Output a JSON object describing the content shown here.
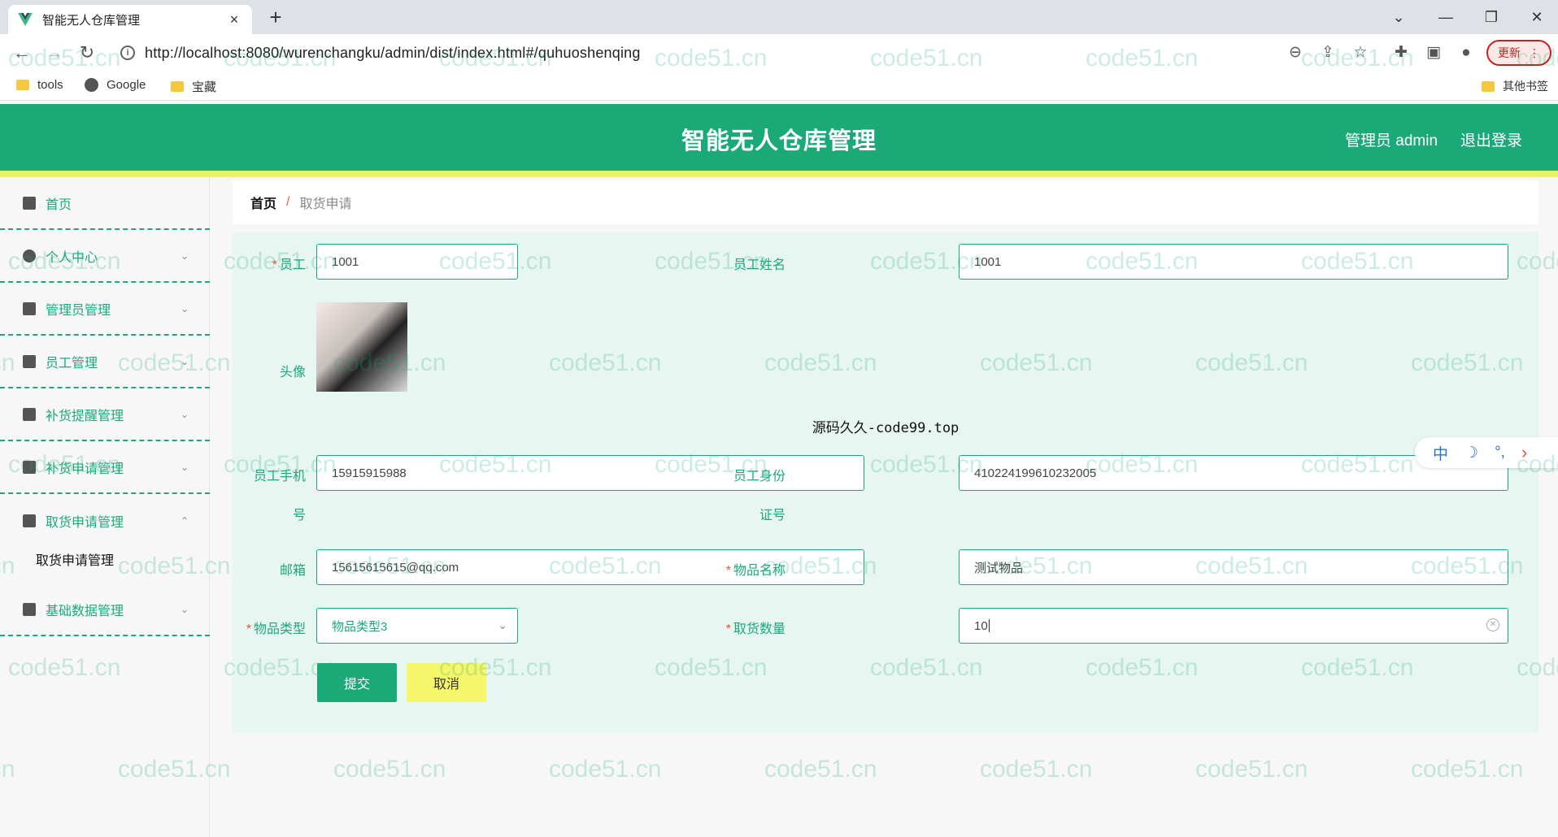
{
  "browser": {
    "tab_title": "智能无人仓库管理",
    "tab_close": "×",
    "new_tab": "+",
    "url": "http://localhost:8080/wurenchangku/admin/dist/index.html#/quhuoshenqing",
    "url_host": "localhost",
    "update_label": "更新",
    "bookmarks": [
      {
        "label": "tools",
        "icon": "folder-icon"
      },
      {
        "label": "Google",
        "icon": "globe-icon"
      },
      {
        "label": "宝藏",
        "icon": "folder-icon"
      }
    ],
    "other_bookmarks": "其他书签"
  },
  "header": {
    "title": "智能无人仓库管理",
    "user": "管理员 admin",
    "logout": "退出登录"
  },
  "sidebar": {
    "items": [
      {
        "label": "首页",
        "icon": "home-icon",
        "arrow": ""
      },
      {
        "label": "个人中心",
        "icon": "user-icon",
        "arrow": "⌄"
      },
      {
        "label": "管理员管理",
        "icon": "briefcase-icon",
        "arrow": "⌄"
      },
      {
        "label": "员工管理",
        "icon": "chat-icon",
        "arrow": "⌄"
      },
      {
        "label": "补货提醒管理",
        "icon": "box-icon",
        "arrow": "⌄"
      },
      {
        "label": "补货申请管理",
        "icon": "grid-icon",
        "arrow": "⌄"
      },
      {
        "label": "取货申请管理",
        "icon": "inbox-icon",
        "arrow": "⌃"
      },
      {
        "label": "基础数据管理",
        "icon": "flag-icon",
        "arrow": "⌄"
      }
    ],
    "submenu": "取货申请管理"
  },
  "breadcrumb": {
    "home": "首页",
    "sep": "/",
    "current": "取货申请"
  },
  "form": {
    "employee_label": "员工",
    "employee_value": "1001",
    "employee_name_label": "员工姓名",
    "employee_name_value": "1001",
    "avatar_label": "头像",
    "watermark_line": "源码久久-code99.top",
    "phone_label_1": "员工手机",
    "phone_label_2": "号",
    "phone_value": "15915915988",
    "id_label_1": "员工身份",
    "id_label_2": "证号",
    "id_value": "410224199610232005",
    "email_label": "邮箱",
    "email_value": "15615615615@qq.com",
    "item_name_label": "物品名称",
    "item_name_value": "测试物品",
    "item_type_label": "物品类型",
    "item_type_value": "物品类型3",
    "qty_label": "取货数量",
    "qty_value": "10",
    "required_mark": "*",
    "submit": "提交",
    "cancel": "取消"
  },
  "ime": {
    "zh": "中",
    "moon": "☽",
    "punct": "°,",
    "arrow": "›"
  },
  "watermark_text": "code51.cn",
  "colors": {
    "accent": "#1baa77",
    "header_stripe": "#eef25c",
    "panel_bg": "#e7f6f0",
    "cancel_bg": "#f5f66a",
    "required": "#e5533d"
  }
}
